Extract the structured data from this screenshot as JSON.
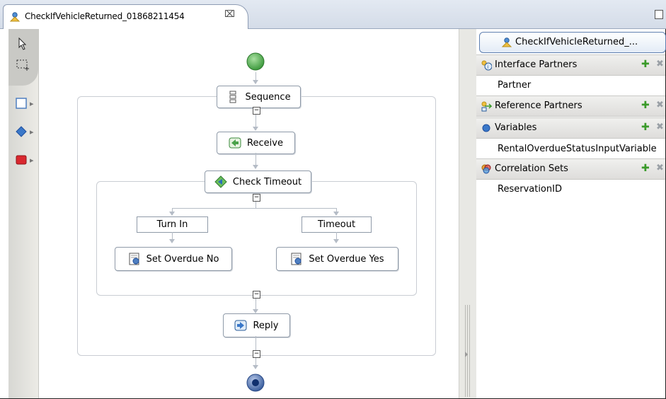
{
  "editor_tab": {
    "title": "CheckIfVehicleReturned_01868211454",
    "close_glyph": "⌧"
  },
  "diagram": {
    "nodes": {
      "sequence": "Sequence",
      "receive": "Receive",
      "check_timeout": "Check Timeout",
      "case_turn_in": "Turn In",
      "case_timeout": "Timeout",
      "set_overdue_no": "Set Overdue No",
      "set_overdue_yes": "Set Overdue Yes",
      "reply": "Reply"
    },
    "collapse_glyph": "−"
  },
  "tray": {
    "title": "CheckIfVehicleReturned_...",
    "categories": [
      {
        "label": "Interface Partners",
        "items": [
          "Partner"
        ]
      },
      {
        "label": "Reference Partners",
        "items": []
      },
      {
        "label": "Variables",
        "items": [
          "RentalOverdueStatusInputVariable"
        ]
      },
      {
        "label": "Correlation Sets",
        "items": [
          "ReservationID"
        ]
      }
    ],
    "add_glyph": "✚",
    "delete_glyph": "✖"
  },
  "colors": {
    "start_node": "#5cb85c",
    "end_node": "#1f4f9e",
    "tab_border": "#8e9cb4",
    "tray_accent": "#5e7fb0"
  }
}
